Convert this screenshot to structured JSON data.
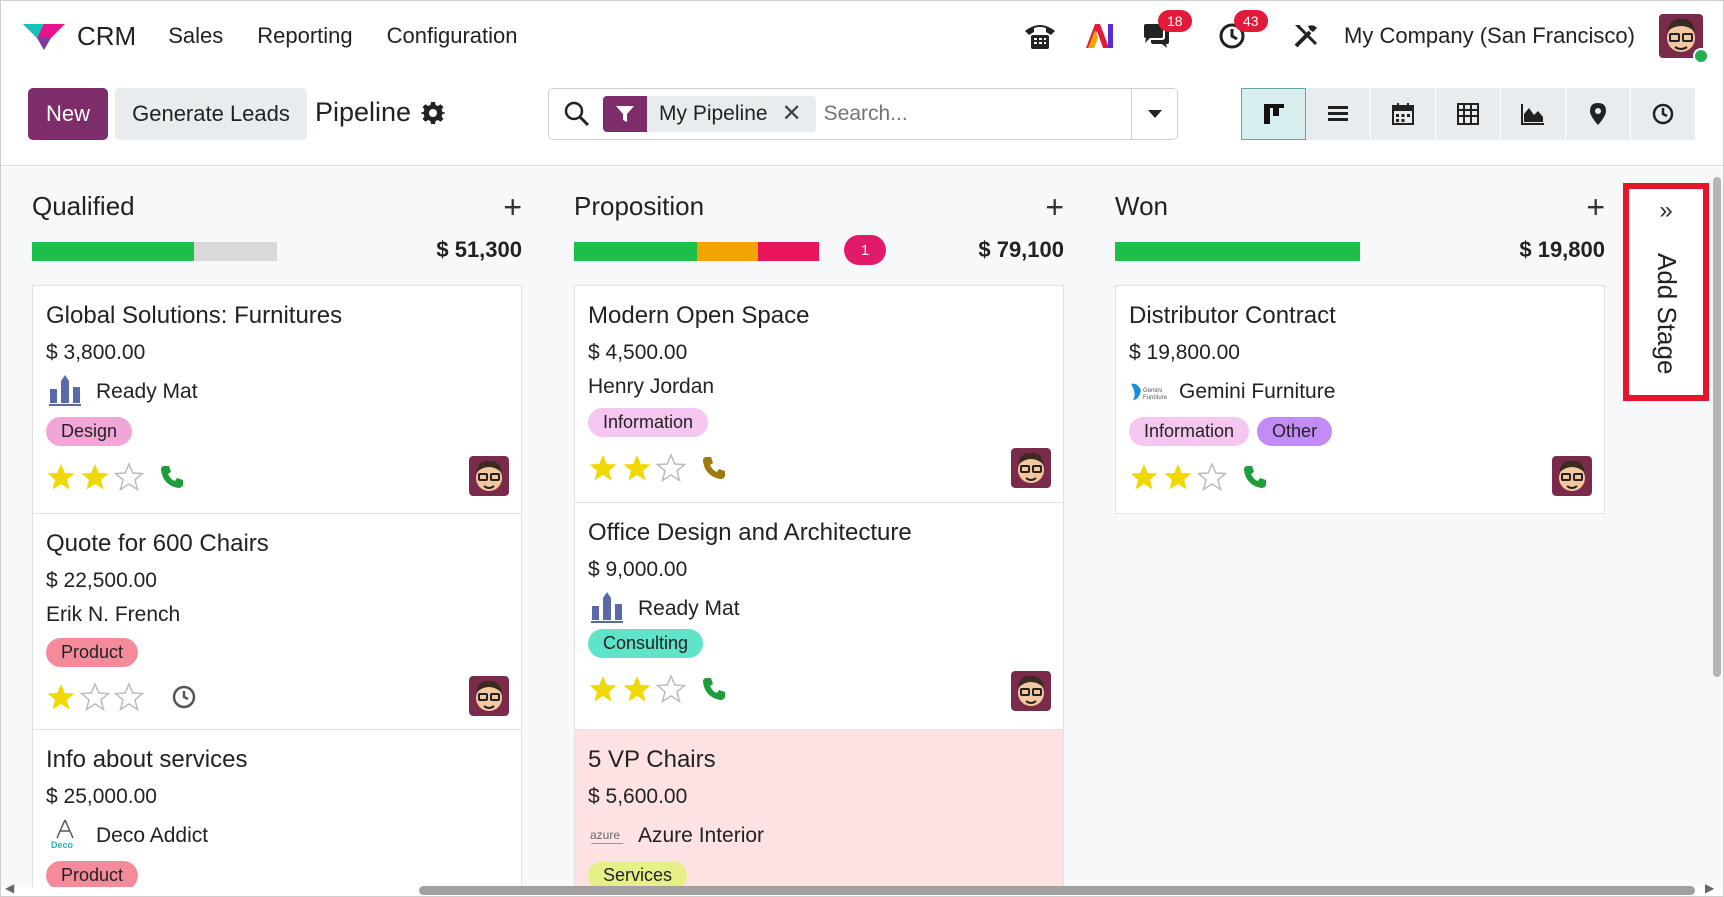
{
  "navbar": {
    "app_name": "CRM",
    "menu": [
      "Sales",
      "Reporting",
      "Configuration"
    ],
    "messages_badge": "18",
    "activities_badge": "43",
    "company": "My Company (San Francisco)"
  },
  "control": {
    "new_label": "New",
    "generate_label": "Generate Leads",
    "title": "Pipeline",
    "facet_label": "My Pipeline",
    "facet_remove": "✕",
    "search_placeholder": "Search...",
    "views": [
      "kanban-view",
      "list-view",
      "calendar-view",
      "pivot-view",
      "graph-view",
      "map-view",
      "activity-view"
    ],
    "active_view": "kanban-view"
  },
  "colors": {
    "primary": "#7c2d6a",
    "progress_won": "#1dbf4a",
    "progress_warning": "#f0a500",
    "progress_danger": "#e9155a",
    "star": "#f0d800",
    "phone_green": "#1e9e3a",
    "phone_brown": "#a07a10"
  },
  "columns": [
    {
      "title": "Qualified",
      "total": "$ 51,300",
      "count": "",
      "progress": [
        {
          "color": "#1dbf4a",
          "fraction": 0.66
        },
        {
          "color": "#d9d9d9",
          "fraction": 0.34
        }
      ],
      "cards": [
        {
          "title": "Global Solutions: Furnitures",
          "amount": "$ 3,800.00",
          "partner": "Ready Mat",
          "logo": "ready-mat-logo",
          "tags": [
            {
              "label": "Design",
              "color": "#f2a6d8"
            }
          ],
          "stars": 2,
          "activity": "phone-green-icon"
        },
        {
          "title": "Quote for 600 Chairs",
          "amount": "$ 22,500.00",
          "partner": "Erik N. French",
          "logo": "",
          "tags": [
            {
              "label": "Product",
              "color": "#f58b9a"
            }
          ],
          "stars": 1,
          "activity": "clock-icon"
        },
        {
          "title": "Info about services",
          "amount": "$ 25,000.00",
          "partner": "Deco Addict",
          "logo": "deco-addict-logo",
          "tags": [
            {
              "label": "Product",
              "color": "#f58b9a"
            }
          ],
          "stars": 0,
          "activity": ""
        }
      ]
    },
    {
      "title": "Proposition",
      "total": "$ 79,100",
      "count": "1",
      "progress": [
        {
          "color": "#1dbf4a",
          "fraction": 0.5
        },
        {
          "color": "#f0a500",
          "fraction": 0.25
        },
        {
          "color": "#e9155a",
          "fraction": 0.25
        }
      ],
      "cards": [
        {
          "title": "Modern Open Space",
          "amount": "$ 4,500.00",
          "partner": "Henry Jordan",
          "logo": "",
          "tags": [
            {
              "label": "Information",
              "color": "#f4c6f0"
            }
          ],
          "stars": 2,
          "activity": "phone-brown-icon"
        },
        {
          "title": "Office Design and Architecture",
          "amount": "$ 9,000.00",
          "partner": "Ready Mat",
          "logo": "ready-mat-logo",
          "tags": [
            {
              "label": "Consulting",
              "color": "#5fe3c9"
            }
          ],
          "stars": 2,
          "activity": "phone-green-icon"
        },
        {
          "title": "5 VP Chairs",
          "amount": "$ 5,600.00",
          "partner": "Azure Interior",
          "logo": "azure-logo",
          "tags": [
            {
              "label": "Services",
              "color": "#e7f086"
            }
          ],
          "stars": 0,
          "activity": ""
        }
      ]
    },
    {
      "title": "Won",
      "total": "$ 19,800",
      "count": "",
      "progress": [
        {
          "color": "#1dbf4a",
          "fraction": 1.0
        }
      ],
      "cards": [
        {
          "title": "Distributor Contract",
          "amount": "$ 19,800.00",
          "partner": "Gemini Furniture",
          "logo": "gemini-logo",
          "tags": [
            {
              "label": "Information",
              "color": "#f4c6f0"
            },
            {
              "label": "Other",
              "color": "#c38bf5"
            }
          ],
          "stars": 2,
          "activity": "phone-green-icon"
        }
      ]
    }
  ],
  "add_stage": {
    "arrow": "»",
    "label": "Add Stage"
  }
}
